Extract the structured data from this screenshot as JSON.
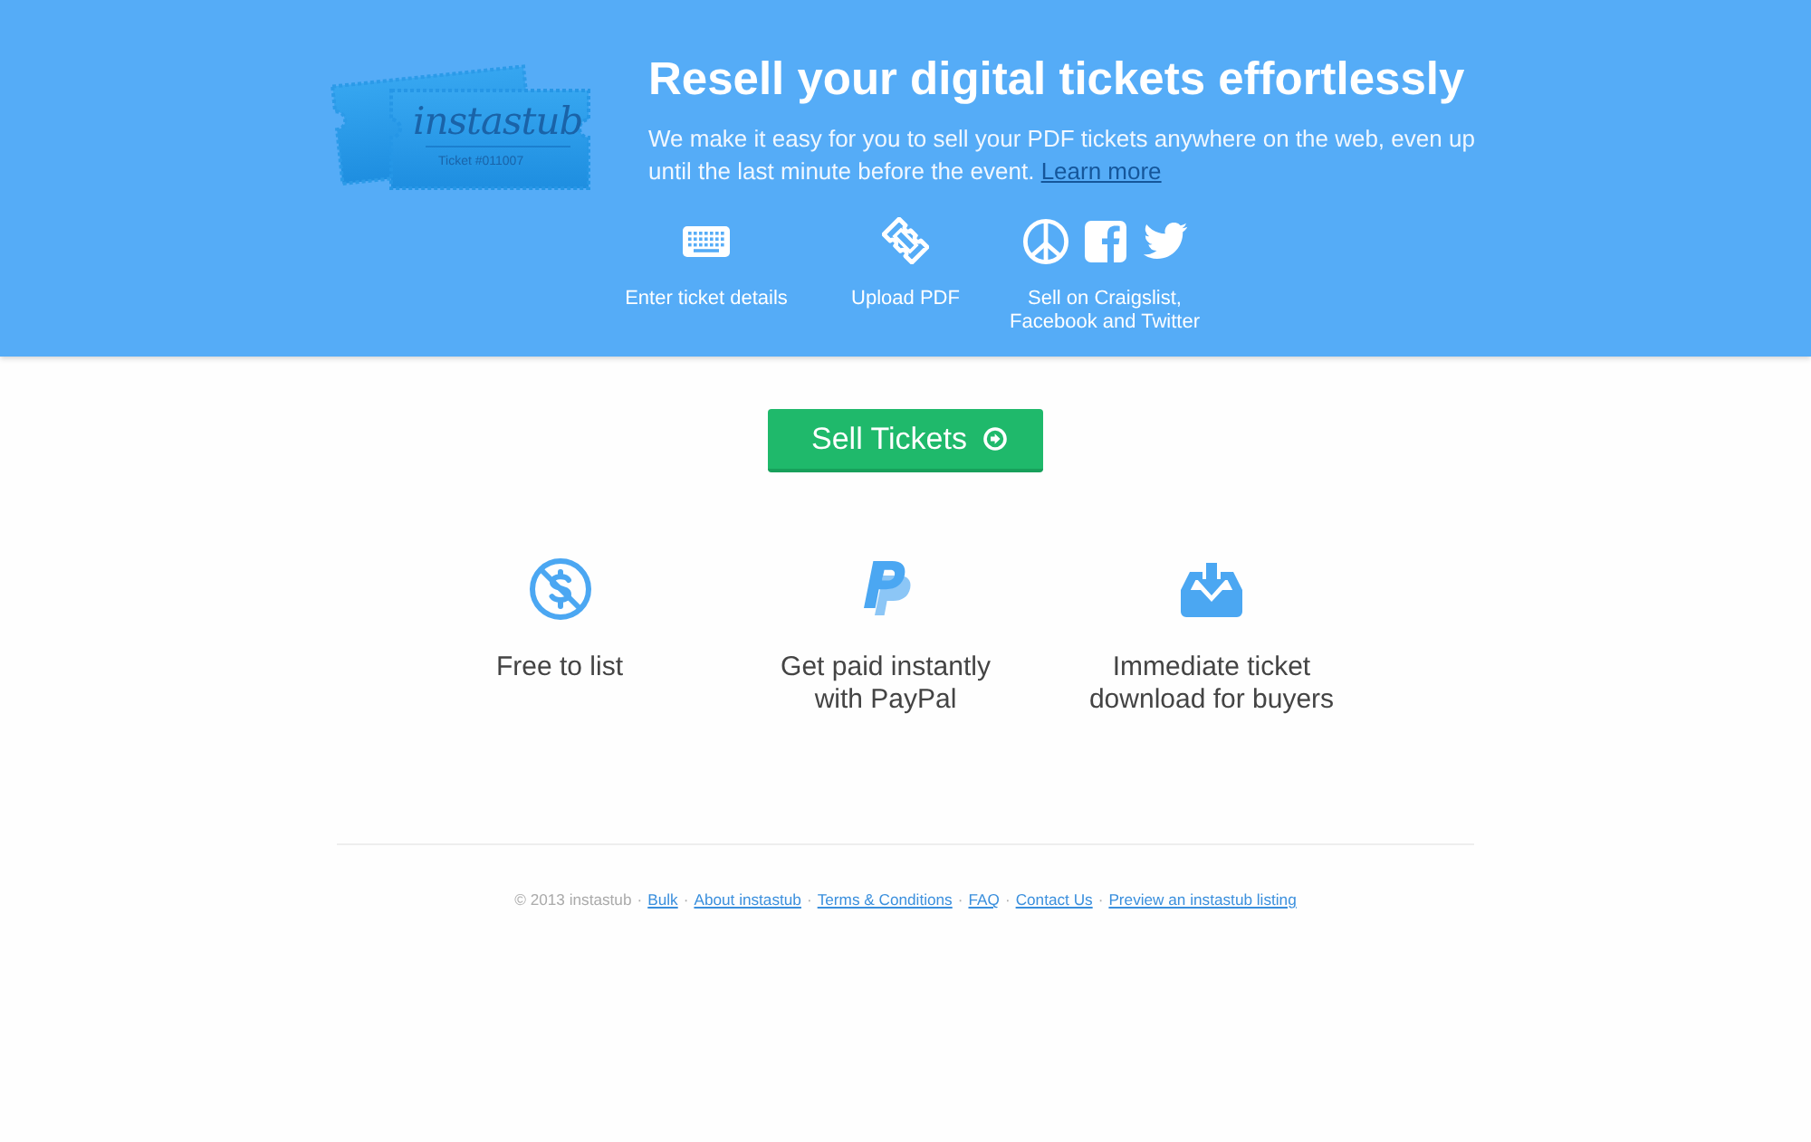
{
  "header": {
    "logo": {
      "wordmark": "instastub",
      "ticket_number": "Ticket #011007"
    },
    "title": "Resell your digital tickets effortlessly",
    "description": "We make it easy for you to sell your PDF tickets anywhere on the web, even up until the last minute before the event.",
    "learn_more_link": "Learn more",
    "steps": [
      {
        "label": "Enter ticket details"
      },
      {
        "label": "Upload PDF"
      },
      {
        "label": "Sell on Craigslist, Facebook and Twitter"
      }
    ]
  },
  "sell_button": "Sell Tickets",
  "features": [
    {
      "label": "Free to list"
    },
    {
      "label": "Get paid instantly with PayPal"
    },
    {
      "label": "Immediate ticket download for buyers"
    }
  ],
  "footer": {
    "items": [
      {
        "kind": "text",
        "text": "© 2013 instastub"
      },
      {
        "kind": "separator",
        "text": "·"
      },
      {
        "kind": "link",
        "text": "Bulk"
      },
      {
        "kind": "separator",
        "text": "·"
      },
      {
        "kind": "link",
        "text": "About instastub"
      },
      {
        "kind": "separator",
        "text": "·"
      },
      {
        "kind": "link",
        "text": "Terms & Conditions"
      },
      {
        "kind": "separator",
        "text": "·"
      },
      {
        "kind": "link",
        "text": "FAQ"
      },
      {
        "kind": "separator",
        "text": "·"
      },
      {
        "kind": "link",
        "text": "Contact Us"
      },
      {
        "kind": "separator",
        "text": "·"
      },
      {
        "kind": "link",
        "text": "Preview an instastub listing"
      }
    ]
  }
}
